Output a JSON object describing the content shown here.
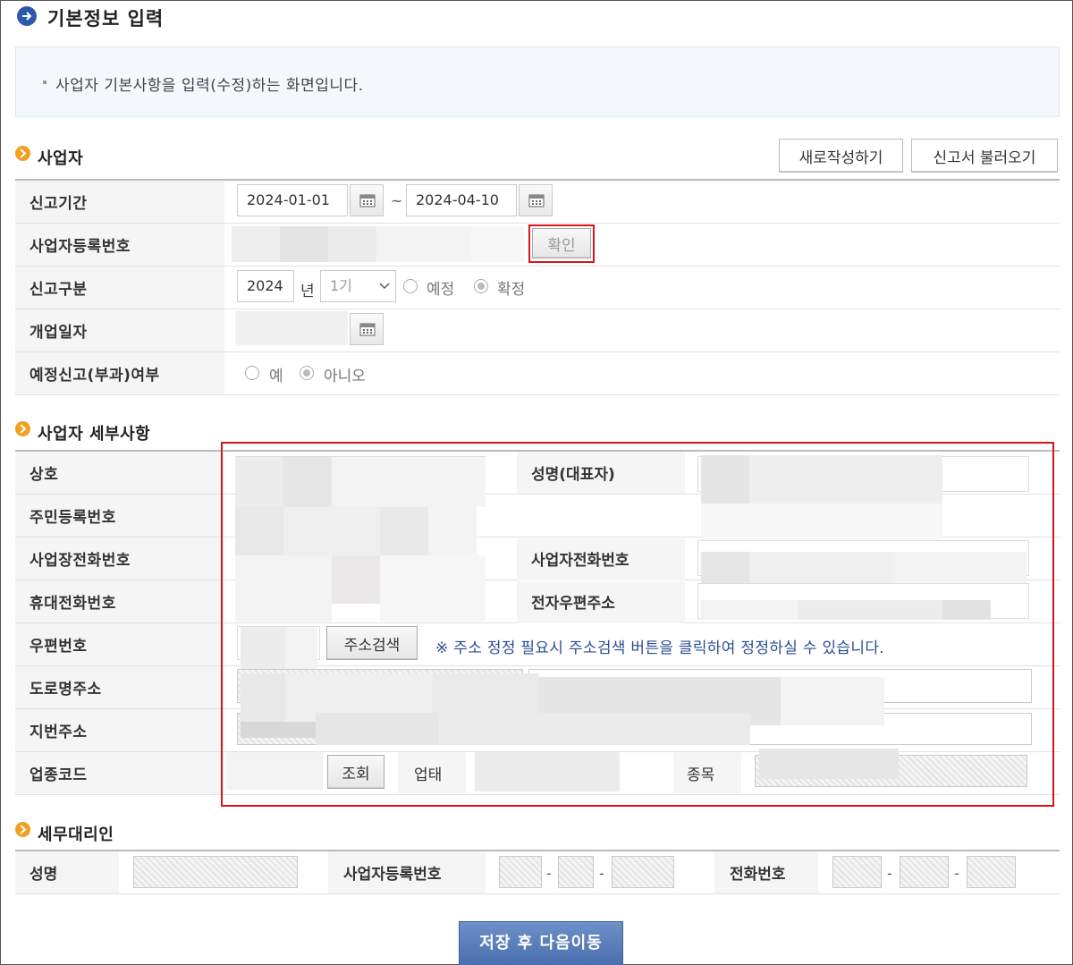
{
  "page": {
    "title": "기본정보 입력",
    "info": "사업자 기본사항을 입력(수정)하는 화면입니다."
  },
  "section_business": {
    "title": "사업자",
    "new_button": "새로작성하기",
    "load_button": "신고서 불러오기",
    "period_label": "신고기간",
    "period_start": "2024-01-01",
    "period_separator": "~",
    "period_end": "2024-04-10",
    "regno_label": "사업자등록번호",
    "confirm_button": "확인",
    "type_label": "신고구분",
    "year": "2024",
    "year_unit": "년",
    "term": "1기",
    "type_options": [
      "예정",
      "확정"
    ],
    "type_selected": "확정",
    "open_date_label": "개업일자",
    "prelim_label": "예정신고(부과)여부",
    "prelim_options": [
      "예",
      "아니오"
    ],
    "prelim_selected": "아니오"
  },
  "section_detail": {
    "title": "사업자 세부사항",
    "labels": {
      "company": "상호",
      "rep_name": "성명(대표자)",
      "resident_no": "주민등록번호",
      "office_phone": "사업장전화번호",
      "owner_phone": "사업자전화번호",
      "mobile": "휴대전화번호",
      "email": "전자우편주소",
      "zipcode": "우편번호",
      "road_address": "도로명주소",
      "lot_address": "지번주소",
      "industry_code": "업종코드",
      "business_type": "업태",
      "business_item": "종목"
    },
    "address_search_button": "주소검색",
    "address_note": "※ 주소 정정 필요시 주소검색 버튼을 클릭하여 정정하실 수 있습니다.",
    "lookup_button": "조회"
  },
  "section_agent": {
    "title": "세무대리인",
    "name_label": "성명",
    "regno_label": "사업자등록번호",
    "phone_label": "전화번호",
    "dash": "-"
  },
  "footer": {
    "save_button": "저장 후 다음이동"
  },
  "colors": {
    "accent_blue": "#2d5aa8",
    "section_icon": "#f0a020",
    "highlight_red": "#d9141c",
    "save_button": "#5b7fbd",
    "note_text": "#2a4d8f"
  }
}
